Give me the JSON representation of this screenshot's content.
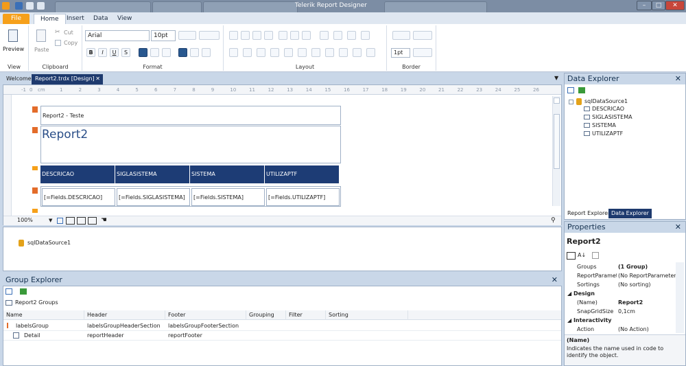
{
  "window": {
    "title": "Telerik Report Designer",
    "controls": {
      "minimize": "–",
      "maximize": "□",
      "close": "✕"
    }
  },
  "menu": {
    "file": "File",
    "tabs": [
      "Home",
      "Insert",
      "Data",
      "View"
    ]
  },
  "ribbon": {
    "view": {
      "preview_label": "Preview",
      "group_label": "View"
    },
    "clipboard": {
      "paste_label": "Paste",
      "cut_label": "Cut",
      "copy_label": "Copy",
      "group_label": "Clipboard"
    },
    "format": {
      "font_family": "Arial",
      "font_size": "10pt",
      "bold": "B",
      "italic": "I",
      "underline": "U",
      "strike": "S",
      "group_label": "Format"
    },
    "layout": {
      "group_label": "Layout"
    },
    "border": {
      "width": "1pt",
      "group_label": "Border"
    }
  },
  "doc_tabs": {
    "welcome": "Welcome",
    "active": "Report2.trdx [Design]",
    "close": "✕"
  },
  "ruler": {
    "labels": [
      "-1",
      "0",
      "cm",
      "1",
      "2",
      "3",
      "4",
      "5",
      "6",
      "7",
      "8",
      "9",
      "10",
      "11",
      "12",
      "13",
      "14",
      "15",
      "16",
      "17",
      "18",
      "19",
      "20",
      "21",
      "22",
      "23",
      "24",
      "25",
      "26"
    ]
  },
  "report": {
    "page_header_text": "Report2 - Teste",
    "title": "Report2",
    "columns": [
      "DESCRICAO",
      "SIGLASISTEMA",
      "SISTEMA",
      "UTILIZAPTF"
    ],
    "fields": [
      "[=Fields.DESCRICAO]",
      "[=Fields.SIGLASISTEMA]",
      "[=Fields.SISTEMA]",
      "[=Fields.UTILIZAPTF]"
    ]
  },
  "zoom": {
    "level": "100%"
  },
  "tray": {
    "datasource": "sqlDataSource1"
  },
  "group_explorer": {
    "title": "Group Explorer",
    "root": "Report2 Groups",
    "headers": [
      "Name",
      "Header",
      "Footer",
      "Grouping",
      "Filter",
      "Sorting"
    ],
    "rows": [
      {
        "name": "labelsGroup",
        "header": "labelsGroupHeaderSection",
        "footer": "labelsGroupFooterSection",
        "grouping": "",
        "filter": "",
        "sorting": ""
      },
      {
        "name": "Detail",
        "header": "reportHeader",
        "footer": "reportFooter",
        "grouping": "",
        "filter": "",
        "sorting": ""
      }
    ]
  },
  "data_explorer": {
    "title": "Data Explorer",
    "datasource": "sqlDataSource1",
    "fields": [
      "DESCRICAO",
      "SIGLASISTEMA",
      "SISTEMA",
      "UTILIZAPTF"
    ],
    "tabs": [
      "Report Explorer",
      "Data Explorer"
    ]
  },
  "properties": {
    "title": "Properties",
    "object_name": "Report2",
    "rows": [
      {
        "name": "Groups",
        "value": "(1 Group)",
        "bold": true
      },
      {
        "name": "ReportParamet",
        "value": "(No ReportParameters)",
        "bold": false
      },
      {
        "name": "Sortings",
        "value": "(No sorting)",
        "bold": false
      }
    ],
    "design_category": "Design",
    "design_rows": [
      {
        "name": "(Name)",
        "value": "Report2",
        "bold": true
      },
      {
        "name": "SnapGridSize",
        "value": "0,1cm",
        "bold": false
      }
    ],
    "interactivity_category": "Interactivity",
    "interactivity_rows": [
      {
        "name": "Action",
        "value": "(No Action)",
        "bold": false
      }
    ],
    "desc_title": "(Name)",
    "desc_text": "Indicates the name used in code to identify the object."
  }
}
